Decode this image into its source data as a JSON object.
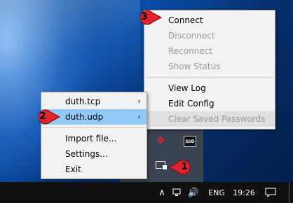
{
  "main_menu": {
    "connect": "Connect",
    "disconnect": "Disconnect",
    "reconnect": "Reconnect",
    "show_status": "Show Status",
    "view_log": "View Log",
    "edit_config": "Edit Config",
    "clear_passwords": "Clear Saved Passwords"
  },
  "profiles_menu": {
    "items": [
      "duth.tcp",
      "duth.udp"
    ],
    "import_file": "Import file...",
    "settings": "Settings...",
    "exit": "Exit"
  },
  "tray_icons": {
    "ssd_label": "SSD"
  },
  "taskbar": {
    "language": "ENG",
    "time": "19:26"
  },
  "badges": [
    "1",
    "2",
    "3"
  ],
  "colors": {
    "highlight": "#91c9f7",
    "badge_red": "#e0222a",
    "disabled_text": "#9a9a9a"
  }
}
